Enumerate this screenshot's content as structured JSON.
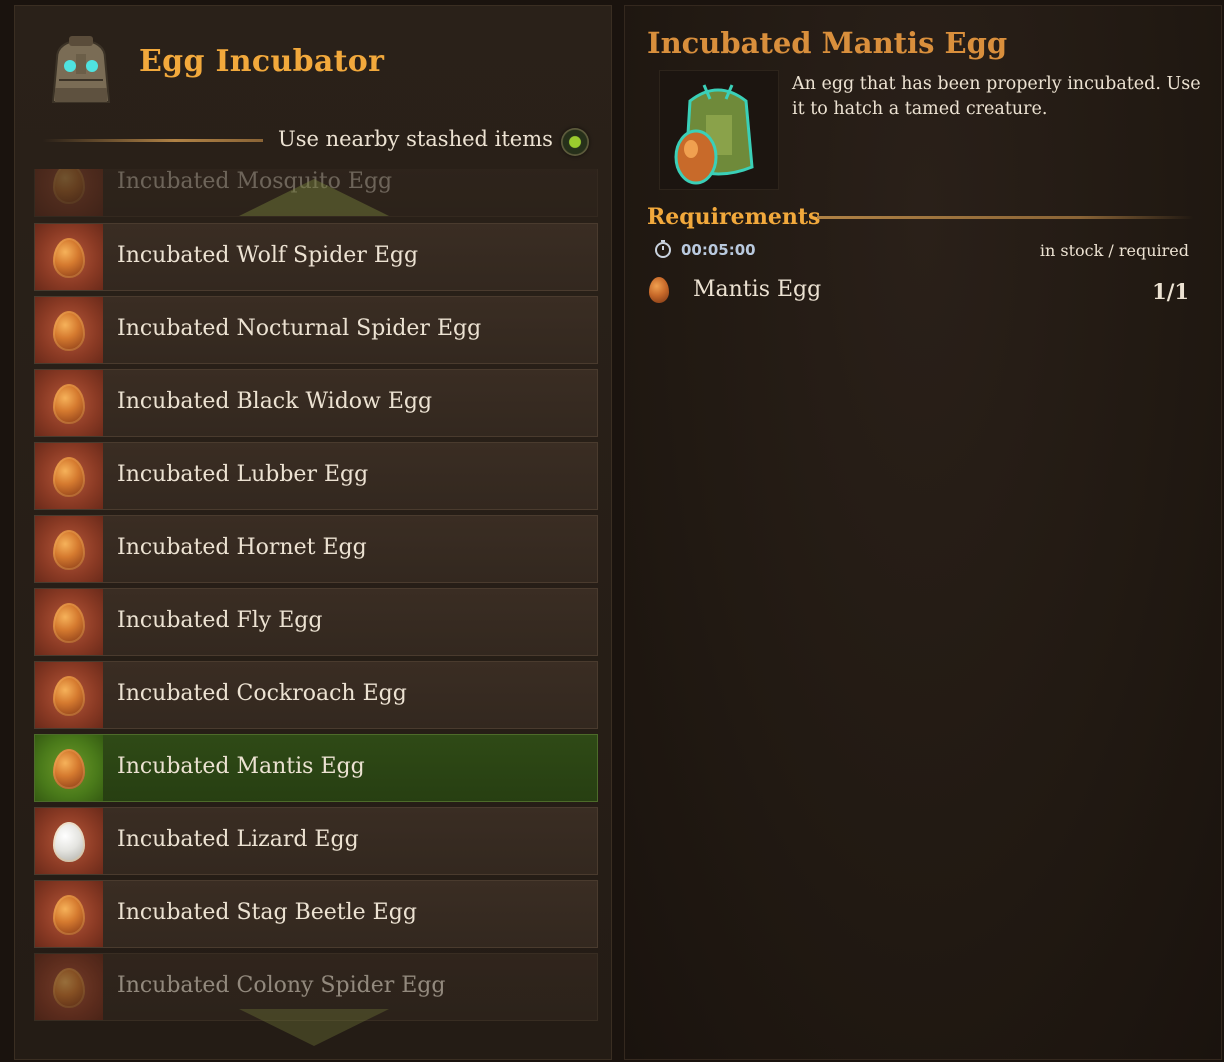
{
  "station": {
    "title": "Egg Incubator",
    "stash_toggle_label": "Use nearby stashed items"
  },
  "recipes": [
    {
      "label": "Incubated Mosquito Egg",
      "egg": "orange",
      "state": "cut"
    },
    {
      "label": "Incubated Wolf Spider Egg",
      "egg": "orange",
      "state": "normal"
    },
    {
      "label": "Incubated Nocturnal Spider Egg",
      "egg": "orange",
      "state": "normal"
    },
    {
      "label": "Incubated Black Widow Egg",
      "egg": "orange",
      "state": "normal"
    },
    {
      "label": "Incubated Lubber Egg",
      "egg": "orange",
      "state": "normal"
    },
    {
      "label": "Incubated Hornet Egg",
      "egg": "orange",
      "state": "normal"
    },
    {
      "label": "Incubated Fly Egg",
      "egg": "orange",
      "state": "normal"
    },
    {
      "label": "Incubated Cockroach Egg",
      "egg": "orange",
      "state": "normal"
    },
    {
      "label": "Incubated Mantis Egg",
      "egg": "orange",
      "state": "selected"
    },
    {
      "label": "Incubated Lizard Egg",
      "egg": "white",
      "state": "normal"
    },
    {
      "label": "Incubated Stag Beetle Egg",
      "egg": "orange",
      "state": "normal"
    },
    {
      "label": "Incubated Colony Spider Egg",
      "egg": "orange",
      "state": "faded"
    }
  ],
  "detail": {
    "title": "Incubated Mantis Egg",
    "description": "An egg that has been properly incubated. Use it to hatch a tamed creature.",
    "requirements_title": "Requirements",
    "craft_time": "00:05:00",
    "stock_label": "in stock / required",
    "ingredients": [
      {
        "name": "Mantis Egg",
        "count": "1/1"
      }
    ]
  },
  "colors": {
    "accent": "#f2a93c",
    "selected_row": "#2f4a16",
    "row_bg": "#3a2d23"
  },
  "icons": {
    "station": "incubator-icon",
    "toggle": "toggle-icon",
    "timer": "stopwatch-icon",
    "egg": "egg-icon"
  }
}
